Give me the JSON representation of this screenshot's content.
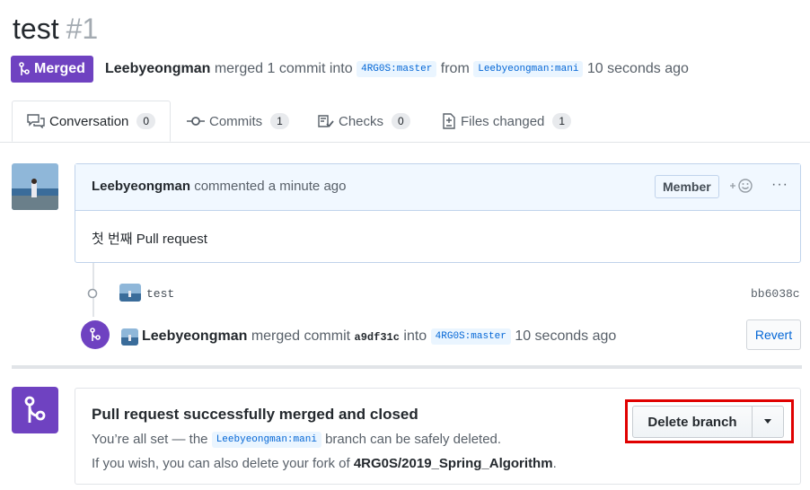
{
  "pr": {
    "title": "test",
    "number": "#1",
    "state_label": "Merged",
    "author": "Leebyeongman",
    "merged_text": "merged 1 commit into",
    "base_ref": "4RG0S:master",
    "from_text": "from",
    "head_ref": "Leebyeongman:mani",
    "time": "10 seconds ago"
  },
  "tabs": [
    {
      "label": "Conversation",
      "count": "0"
    },
    {
      "label": "Commits",
      "count": "1"
    },
    {
      "label": "Checks",
      "count": "0"
    },
    {
      "label": "Files changed",
      "count": "1"
    }
  ],
  "comment": {
    "author": "Leebyeongman",
    "action": "commented a minute ago",
    "badge": "Member",
    "body": "첫 번째 Pull request"
  },
  "commit": {
    "message": "test",
    "sha": "bb6038c"
  },
  "merge_event": {
    "author": "Leebyeongman",
    "text": "merged commit",
    "sha": "a9df31c",
    "into_text": "into",
    "ref": "4RG0S:master",
    "time": "10 seconds ago",
    "revert_label": "Revert"
  },
  "merge_box": {
    "title": "Pull request successfully merged and closed",
    "line1_before": "You’re all set — the",
    "line1_ref": "Leebyeongman:mani",
    "line1_after": "branch can be safely deleted.",
    "line2_before": "If you wish, you can also delete your fork of",
    "line2_repo": "4RG0S/2019_Spring_Algorithm",
    "line2_after": ".",
    "delete_label": "Delete branch"
  },
  "colors": {
    "merged_purple": "#6f42c1",
    "link_blue": "#0366d6",
    "highlight_red": "#e00000"
  }
}
